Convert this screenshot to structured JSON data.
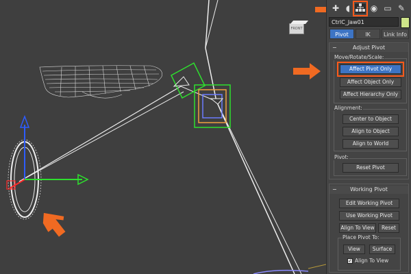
{
  "object_name": "CtrlC_Jaw01",
  "colors": {
    "accent_selected": "#3d74c4",
    "highlight_arrow": "#f06a22",
    "swatch": "#cfe58a"
  },
  "command_panel_icons": [
    "create-icon",
    "modify-icon",
    "hierarchy-icon",
    "motion-icon",
    "display-icon",
    "utilities-icon"
  ],
  "tabs": [
    {
      "label": "Pivot",
      "active": true
    },
    {
      "label": "IK",
      "active": false
    },
    {
      "label": "Link Info",
      "active": false
    }
  ],
  "adjust_pivot": {
    "title": "Adjust Pivot",
    "collapse_symbol": "−",
    "group_move": {
      "label": "Move/Rotate/Scale:",
      "buttons": [
        "Affect Pivot Only",
        "Affect Object Only",
        "Affect Hierarchy Only"
      ]
    },
    "group_alignment": {
      "label": "Alignment:",
      "buttons": [
        "Center to Object",
        "Align to Object",
        "Align to World"
      ]
    },
    "group_pivot": {
      "label": "Pivot:",
      "buttons": [
        "Reset Pivot"
      ]
    }
  },
  "working_pivot": {
    "title": "Working Pivot",
    "collapse_symbol": "−",
    "buttons": [
      "Edit Working Pivot",
      "Use Working Pivot",
      "Align To View",
      "Reset"
    ],
    "place_group": {
      "label": "Place Pivot To:",
      "buttons": [
        "View",
        "Surface"
      ],
      "checkbox_label": "Align To View",
      "checkbox_checked": true
    }
  },
  "viewcube_label": "FRONT"
}
